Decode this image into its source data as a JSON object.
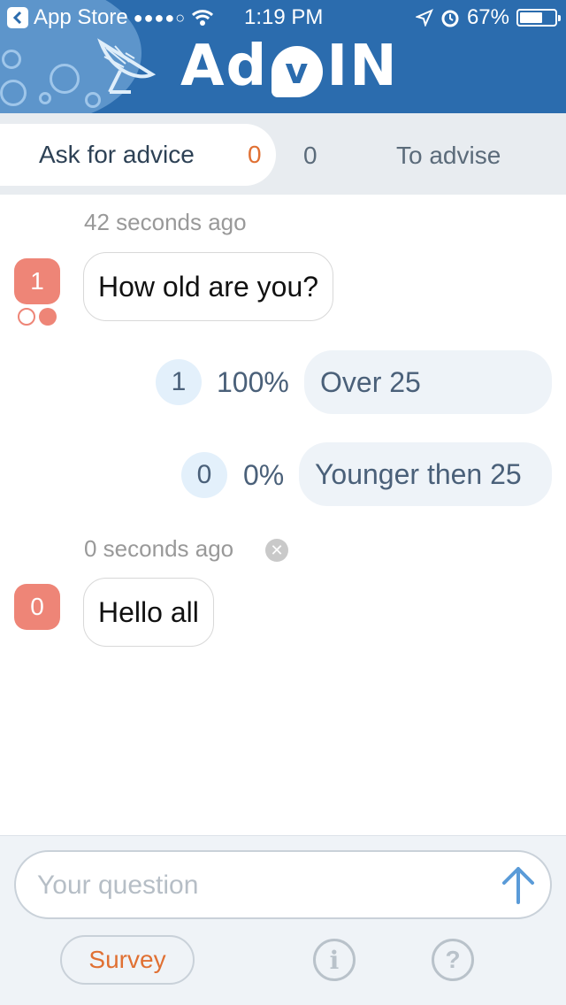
{
  "status_bar": {
    "back_app": "App Store",
    "signal": "●●●●○",
    "time": "1:19 PM",
    "battery": "67%",
    "battery_level": 0.67
  },
  "header": {
    "logo_prefix": "Ad",
    "logo_mark": "v",
    "logo_suffix": "IN",
    "accent_color": "#2b6cae"
  },
  "tabs": {
    "ask_label": "Ask for advice",
    "ask_count": "0",
    "advise_count": "0",
    "advise_label": "To advise"
  },
  "messages": [
    {
      "time": "42 seconds ago",
      "avatar": "1",
      "text": "How old are you?",
      "answers": [
        {
          "count": "1",
          "percent": "100%",
          "label": "Over 25"
        },
        {
          "count": "0",
          "percent": "0%",
          "label": "Younger then 25"
        }
      ]
    },
    {
      "time": "0 seconds ago",
      "avatar": "0",
      "text": "Hello all"
    }
  ],
  "composer": {
    "placeholder": "Your question",
    "survey_label": "Survey",
    "info_glyph": "i",
    "help_glyph": "?"
  },
  "colors": {
    "avatar": "#ee8577",
    "orange": "#e07033"
  }
}
